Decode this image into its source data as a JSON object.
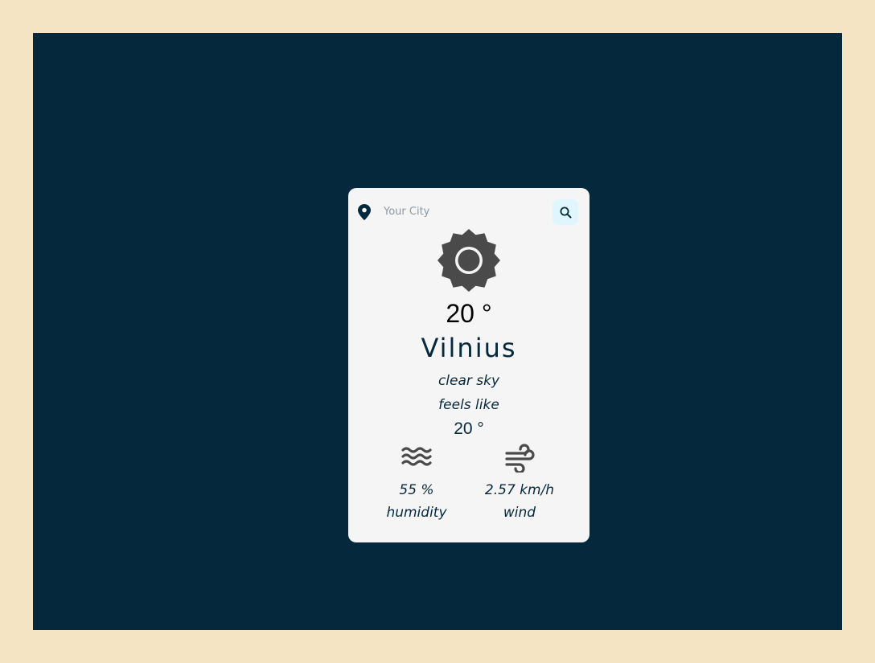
{
  "search": {
    "placeholder": "Your City",
    "value": ""
  },
  "weather": {
    "icon": "sun-icon",
    "temperature": "20 °",
    "city": "Vilnius",
    "description": "clear sky",
    "feels_like_label": "feels like",
    "feels_like_value": "20 °"
  },
  "stats": {
    "humidity": {
      "icon": "waves-icon",
      "value": "55 %",
      "label": "humidity"
    },
    "wind": {
      "icon": "wind-icon",
      "value": "2.57 km/h",
      "label": "wind"
    }
  },
  "colors": {
    "page_background": "#f5e4c3",
    "frame_background": "#06283d",
    "card_background": "#f5f5f5",
    "search_button": "#dff6ff",
    "text": "#06283d",
    "icon": "#4a4a4a"
  }
}
